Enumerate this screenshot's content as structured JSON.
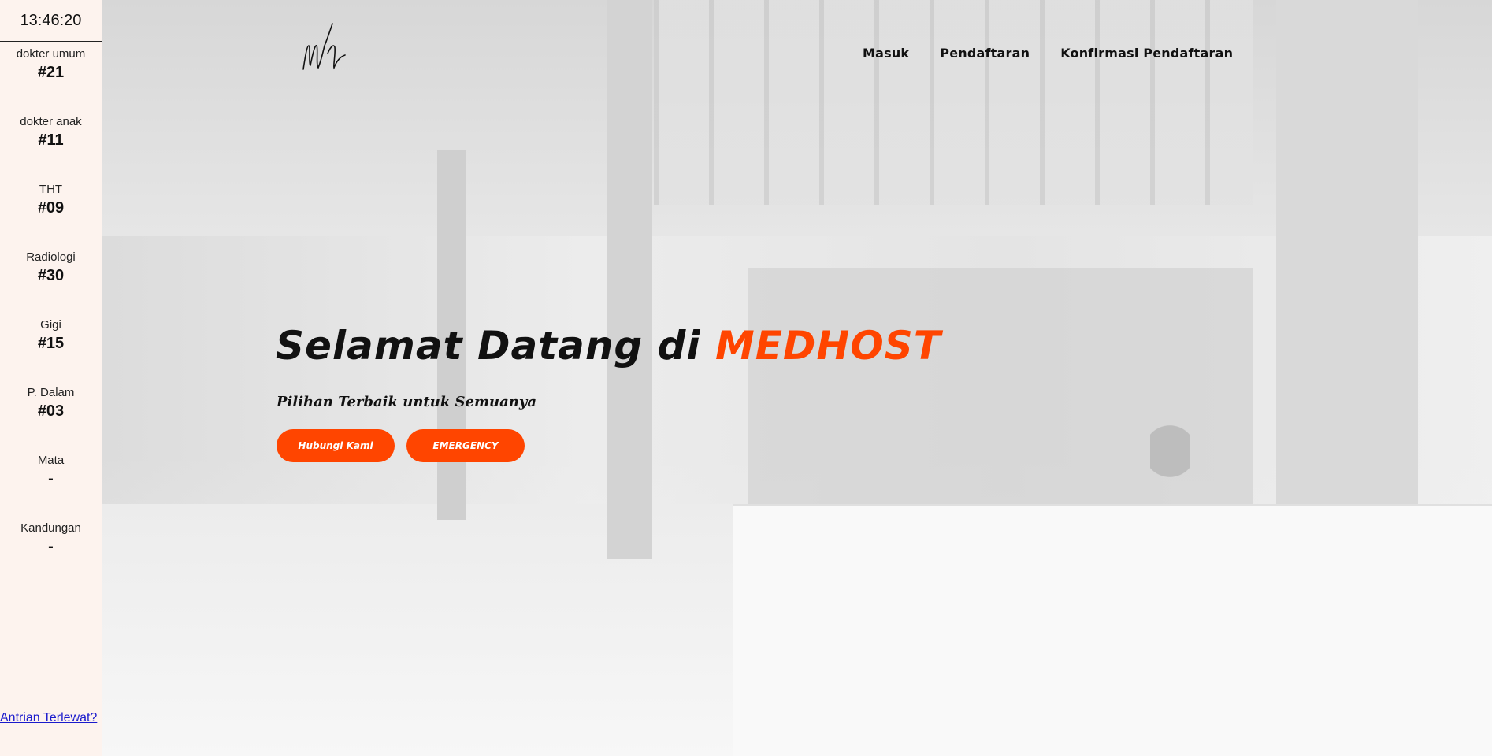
{
  "sidebar": {
    "clock": "13:46:20",
    "queues": [
      {
        "name": "dokter umum",
        "number": "#21"
      },
      {
        "name": "dokter anak",
        "number": "#11"
      },
      {
        "name": "THT",
        "number": "#09"
      },
      {
        "name": "Radiologi",
        "number": "#30"
      },
      {
        "name": "Gigi",
        "number": "#15"
      },
      {
        "name": "P. Dalam",
        "number": "#03"
      },
      {
        "name": "Mata",
        "number": "-"
      },
      {
        "name": "Kandungan",
        "number": "-"
      }
    ],
    "missed_link": "Antrian Terlewat?"
  },
  "nav": {
    "login": "Masuk",
    "register": "Pendaftaran",
    "confirm": "Konfirmasi Pendaftaran"
  },
  "hero": {
    "headline_prefix": "Selamat Datang di ",
    "brand": "MEDHOST",
    "tagline": "Pilihan Terbaik untuk Semuanya",
    "contact_button": "Hubungi Kami",
    "emergency_button": "EMERGENCY"
  },
  "colors": {
    "accent": "#ff4500",
    "sidebar_bg": "#fdf3ee"
  }
}
